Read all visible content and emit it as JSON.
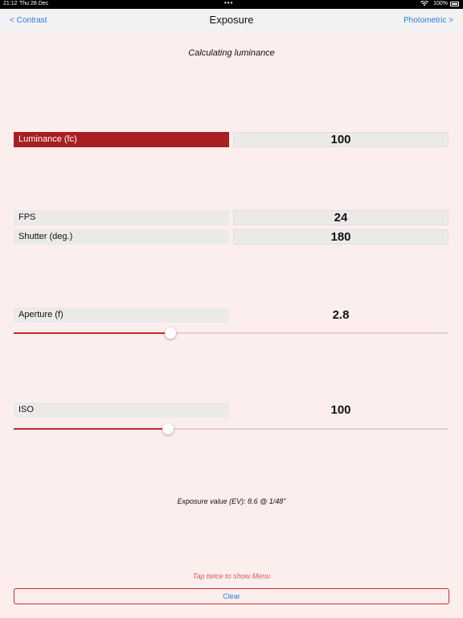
{
  "status_bar": {
    "time": "21:12",
    "date": "Thu 28 Dec",
    "battery": "100%"
  },
  "nav": {
    "back_label": "< Contrast",
    "title": "Exposure",
    "forward_label": "Photometric >"
  },
  "subtitle": "Calculating luminance",
  "luminance": {
    "label": "Luminance (fc)",
    "value": "100"
  },
  "fps": {
    "label": "FPS",
    "value": "24"
  },
  "shutter": {
    "label": "Shutter (deg.)",
    "value": "180"
  },
  "aperture": {
    "label": "Aperture (f)",
    "value": "2.8",
    "slider_fraction": 0.36
  },
  "iso": {
    "label": "ISO",
    "value": "100",
    "slider_fraction": 0.355
  },
  "exposure_value": "Exposure value (EV): 8.6 @ 1/48\"",
  "menu_hint": "Tap twice to show Menu",
  "clear_label": "Clear",
  "colors": {
    "accent": "#a81e22",
    "link": "#2a7ee0",
    "background": "#fdeeee"
  }
}
